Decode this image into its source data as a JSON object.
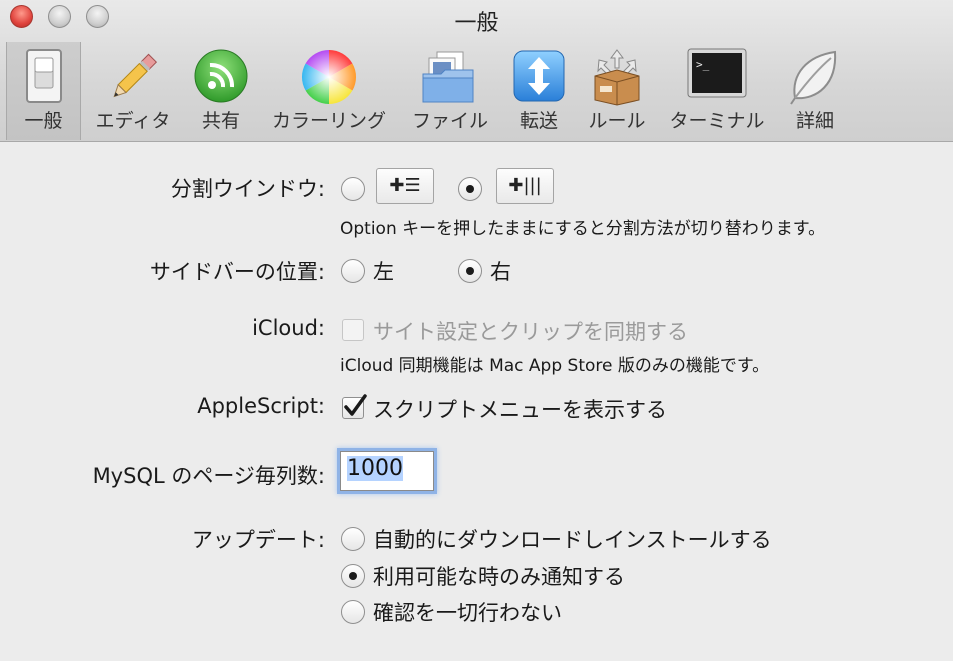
{
  "window": {
    "title": "一般"
  },
  "toolbar": {
    "items": [
      {
        "label": "一般",
        "icon": "switch-icon",
        "selected": true
      },
      {
        "label": "エディタ",
        "icon": "pencil-icon"
      },
      {
        "label": "共有",
        "icon": "sharing-icon"
      },
      {
        "label": "カラーリング",
        "icon": "color-wheel-icon"
      },
      {
        "label": "ファイル",
        "icon": "files-icon"
      },
      {
        "label": "転送",
        "icon": "transfer-icon"
      },
      {
        "label": "ルール",
        "icon": "rules-box-icon"
      },
      {
        "label": "ターミナル",
        "icon": "terminal-icon"
      },
      {
        "label": "詳細",
        "icon": "leaf-icon"
      }
    ]
  },
  "split_window": {
    "label": "分割ウインドウ:",
    "option_horizontal": "✚☰",
    "option_vertical": "✚|||",
    "selected": "vertical",
    "note": "Option キーを押したままにすると分割方法が切り替わります。"
  },
  "sidebar": {
    "label": "サイドバーの位置:",
    "left": "左",
    "right": "右",
    "selected": "right"
  },
  "icloud": {
    "label": "iCloud:",
    "checkbox_label": "サイト設定とクリップを同期する",
    "checked": false,
    "enabled": false,
    "note": "iCloud 同期機能は Mac App Store 版のみの機能です。"
  },
  "applescript": {
    "label": "AppleScript:",
    "checkbox_label": "スクリプトメニューを表示する",
    "checked": true
  },
  "mysql": {
    "label": "MySQL のページ毎列数:",
    "value": "1000"
  },
  "update": {
    "label": "アップデート:",
    "options": [
      "自動的にダウンロードしインストールする",
      "利用可能な時のみ通知する",
      "確認を一切行わない"
    ],
    "selected_index": 1
  },
  "colors": {
    "accent": "#3b7ddd",
    "focus_ring": "#8fb3e6",
    "selection": "#b5d3ff"
  }
}
